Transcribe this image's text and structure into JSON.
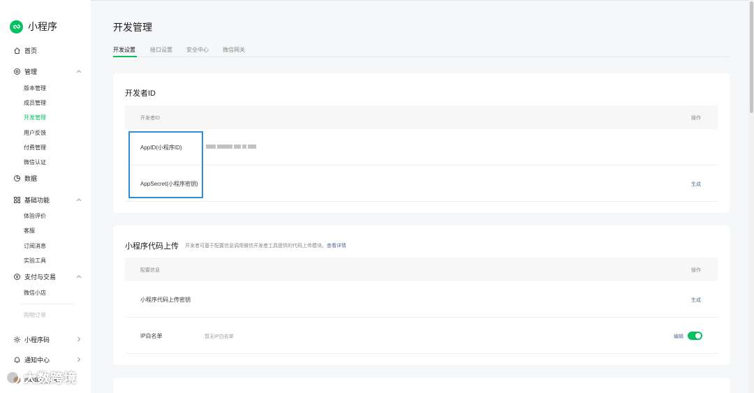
{
  "app": {
    "title": "小程序"
  },
  "sidebar": {
    "home": "首页",
    "manage": {
      "label": "管理",
      "items": [
        "版本管理",
        "成员管理",
        "开发管理",
        "用户反馈",
        "付费管理",
        "微信认证"
      ]
    },
    "data": "数据",
    "basic": {
      "label": "基础功能",
      "items": [
        "体验评价",
        "客服",
        "订阅消息",
        "实验工具"
      ]
    },
    "pay": {
      "label": "支付与交易",
      "items": [
        "微信小店"
      ]
    },
    "shopping_order": "购物订单",
    "miniprogram_code": "小程序码",
    "notify": "通知中心",
    "account": "media_l_1a"
  },
  "header": {
    "title": "开发管理"
  },
  "tabs": [
    "开发设置",
    "接口设置",
    "安全中心",
    "微信网关"
  ],
  "dev_id_card": {
    "title": "开发者ID",
    "col_id": "开发者ID",
    "col_action": "操作",
    "rows": [
      {
        "label": "AppID(小程序ID)",
        "action": ""
      },
      {
        "label": "AppSecret(小程序密钥)",
        "action": "生成"
      }
    ]
  },
  "upload_card": {
    "title": "小程序代码上传",
    "desc": "开发者可基于配置信息调用微信开发者工具提供的代码上传模块。",
    "desc_link": "查看详情",
    "col_config": "配置信息",
    "col_action": "操作",
    "rows": [
      {
        "label": "小程序代码上传密钥",
        "value": "",
        "action": "生成"
      },
      {
        "label": "IP白名单",
        "value": "暂无IP白名单",
        "action": "编辑",
        "toggle_on": true
      }
    ]
  },
  "watermark": "大数跨境",
  "colors": {
    "brand": "#07c160",
    "link": "#576b95",
    "highlight": "#2b8fe0"
  }
}
